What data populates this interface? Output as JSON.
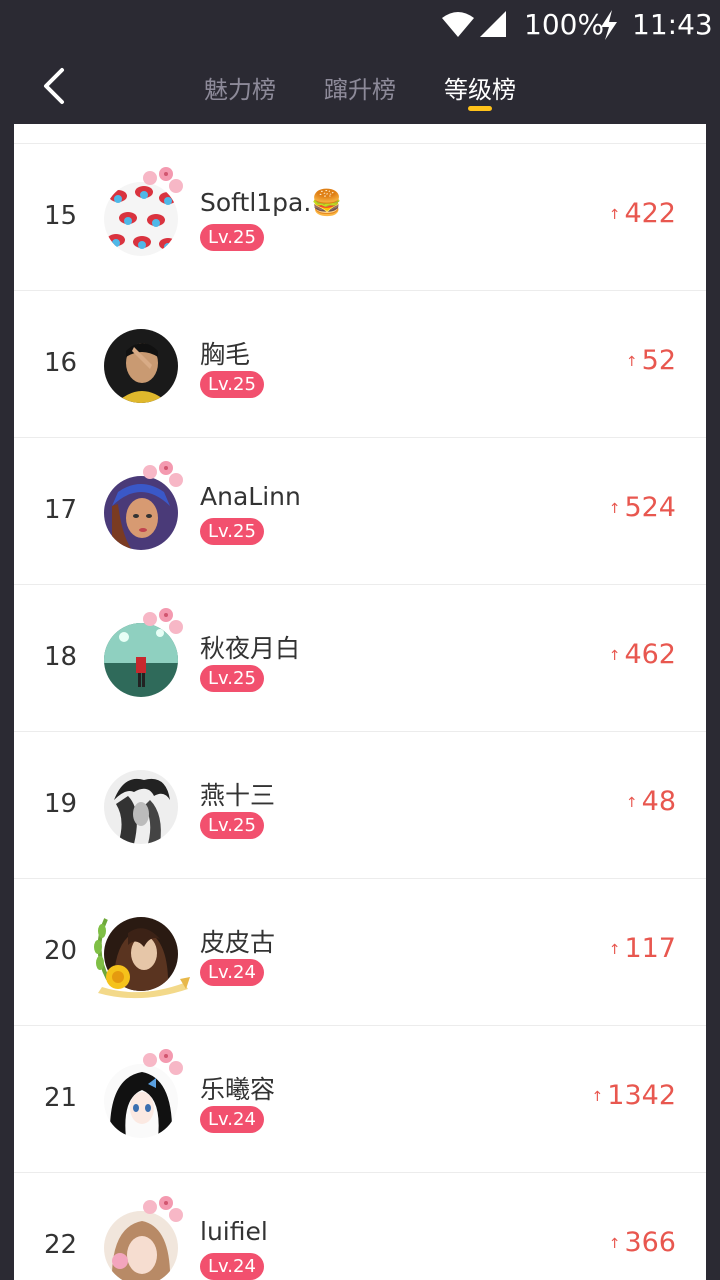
{
  "status_bar": {
    "battery": "100%",
    "time": "11:43"
  },
  "nav": {
    "tabs": [
      {
        "label": "魅力榜",
        "active": false
      },
      {
        "label": "蹿升榜",
        "active": false
      },
      {
        "label": "等级榜",
        "active": true
      }
    ],
    "accent_color": "#ffc21a"
  },
  "ranking": {
    "rows": [
      {
        "rank": "15",
        "name": "Softl1pa.🍔",
        "level": "Lv.25",
        "score": "422"
      },
      {
        "rank": "16",
        "name": "胸毛",
        "level": "Lv.25",
        "score": "52"
      },
      {
        "rank": "17",
        "name": "AnaLinn",
        "level": "Lv.25",
        "score": "524"
      },
      {
        "rank": "18",
        "name": "秋夜月白",
        "level": "Lv.25",
        "score": "462"
      },
      {
        "rank": "19",
        "name": "燕十三",
        "level": "Lv.25",
        "score": "48"
      },
      {
        "rank": "20",
        "name": "皮皮古",
        "level": "Lv.24",
        "score": "117"
      },
      {
        "rank": "21",
        "name": "乐曦容",
        "level": "Lv.24",
        "score": "1342"
      },
      {
        "rank": "22",
        "name": "luifiel",
        "level": "Lv.24",
        "score": "366"
      }
    ],
    "score_arrow": "↑",
    "level_badge_color": "#f2506e",
    "score_color": "#e8574f"
  }
}
